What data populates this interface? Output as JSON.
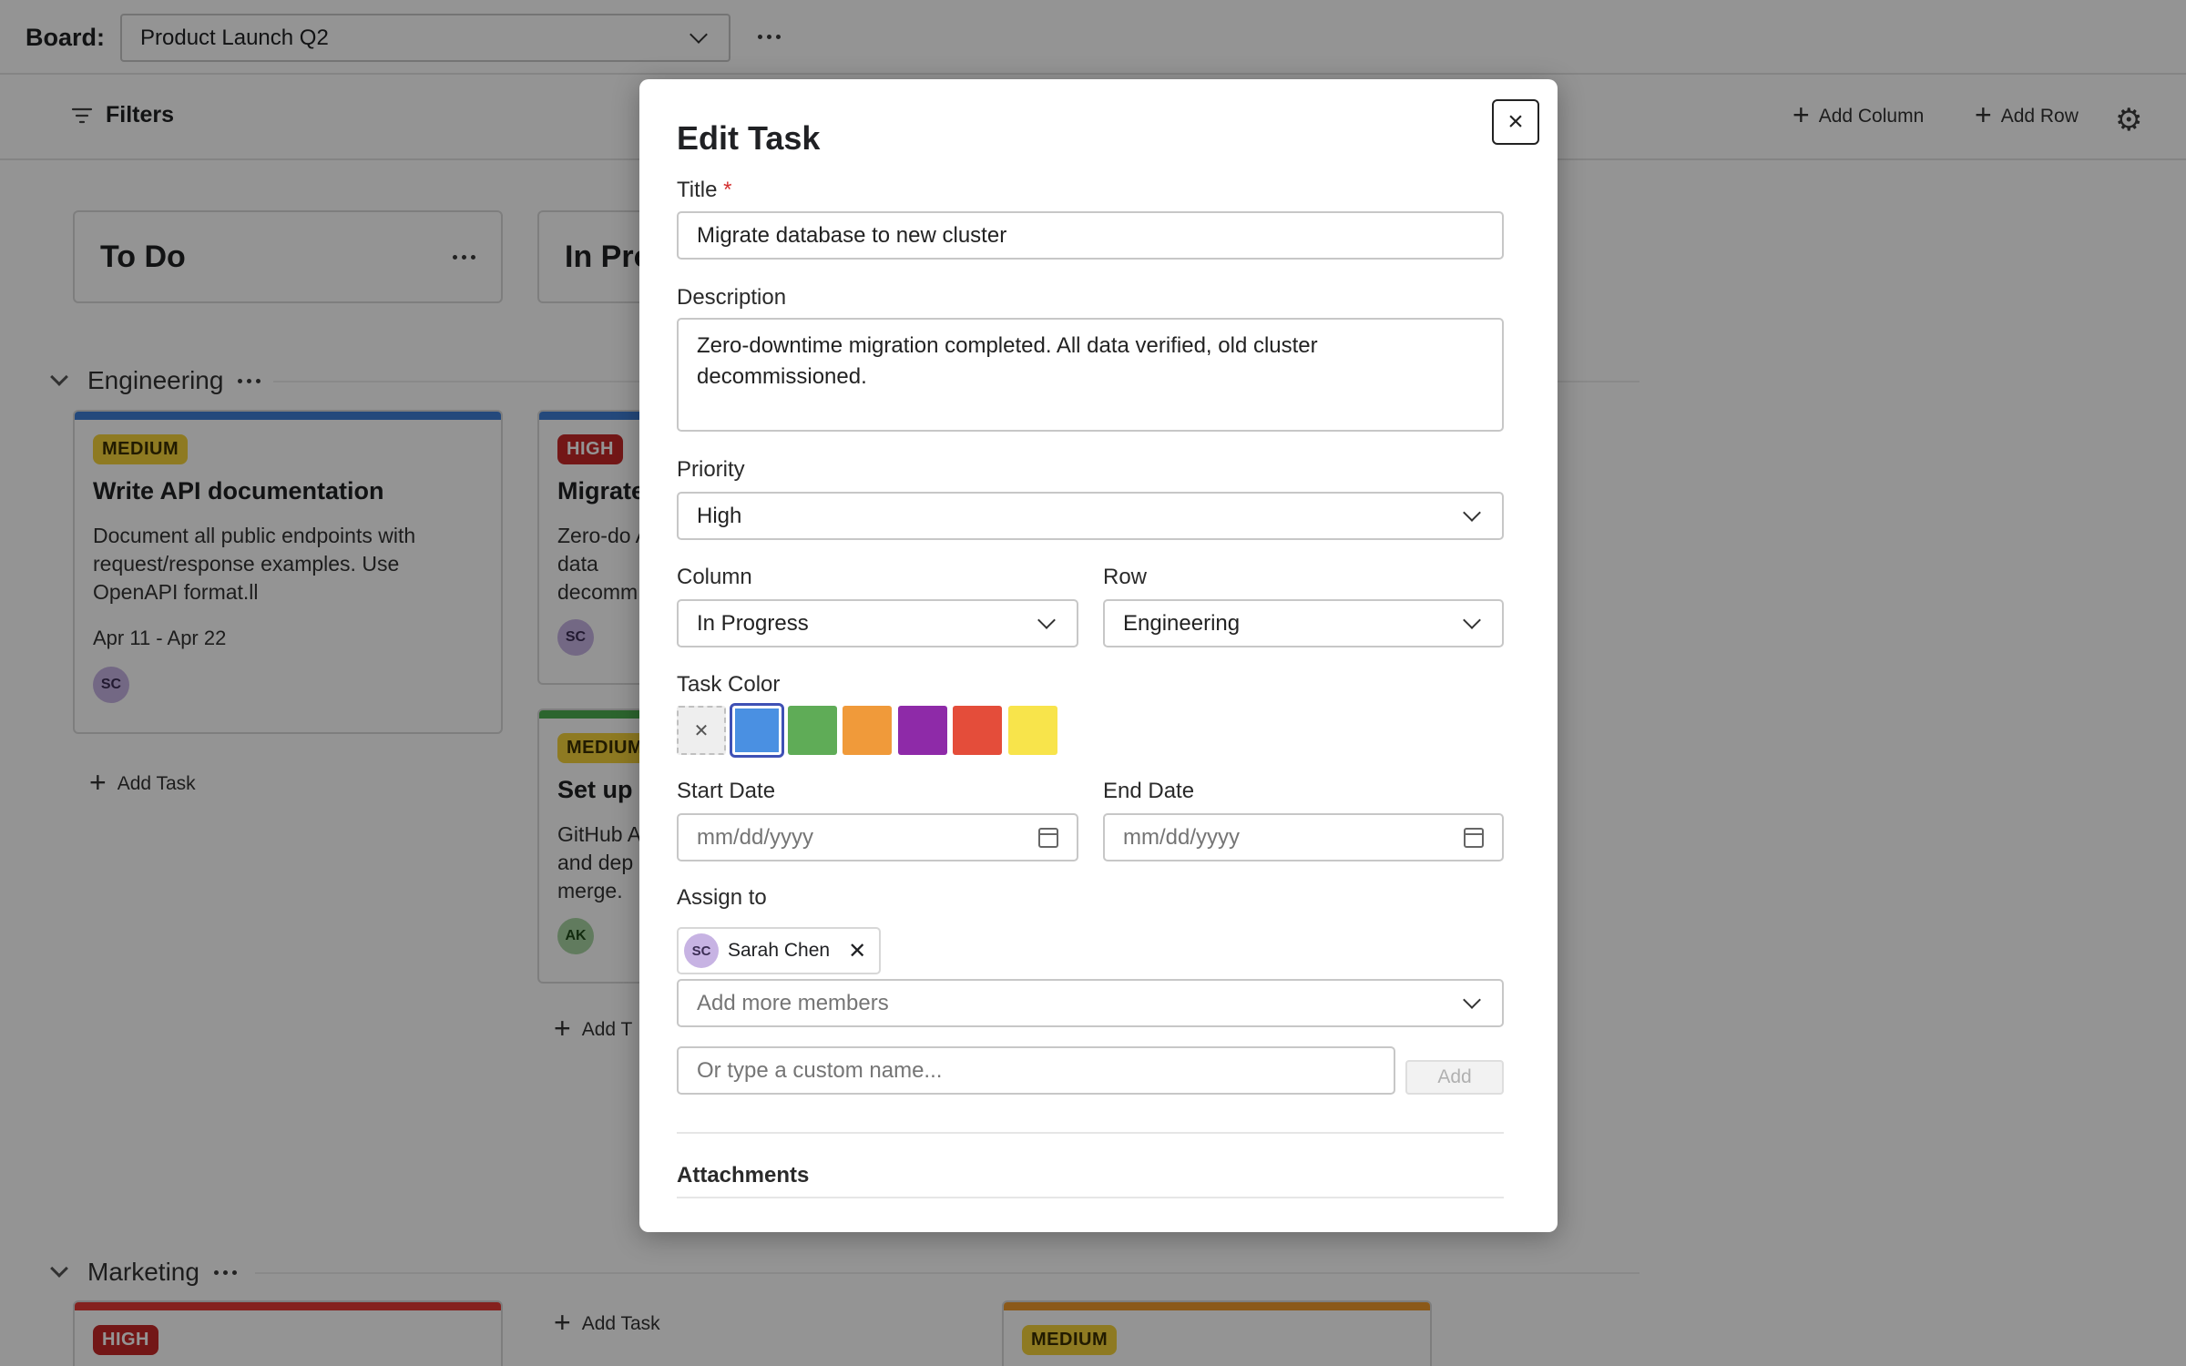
{
  "header": {
    "board_label": "Board:",
    "board_value": "Product Launch Q2"
  },
  "toolbar": {
    "filters": "Filters",
    "add_column": "Add Column",
    "add_row": "Add Row"
  },
  "columns": [
    {
      "label": "To Do"
    },
    {
      "label": "In Pro"
    }
  ],
  "groups": {
    "engineering": "Engineering",
    "marketing": "Marketing"
  },
  "cards": {
    "c1": {
      "priority": "MEDIUM",
      "title": "Write API documentation",
      "desc": "Document all public endpoints with request/response examples. Use OpenAPI format.ll",
      "dates": "Apr 11  -  Apr 22",
      "assignee": "SC",
      "stripe": "#3f7fd6"
    },
    "c2": {
      "priority": "HIGH",
      "title": "Migrate",
      "desc": "Zero-do All data decomm",
      "assignee": "SC",
      "stripe": "#3f7fd6"
    },
    "c3": {
      "priority": "MEDIUM",
      "title": "Set up",
      "desc": "GitHub A and dep merge.",
      "assignee": "AK",
      "stripe": "#4caf50"
    },
    "c4": {
      "priority": "HIGH",
      "stripe": "#e53935"
    },
    "c5": {
      "priority": "MEDIUM",
      "stripe": "#f09a2c"
    }
  },
  "add_task": "Add Task",
  "add_task_partial": "Add T",
  "modal": {
    "title": "Edit Task",
    "title_label": "Title",
    "required_mark": "*",
    "title_value": "Migrate database to new cluster",
    "description_label": "Description",
    "description_value": "Zero-downtime migration completed. All data verified, old cluster decommissioned.",
    "priority_label": "Priority",
    "priority_value": "High",
    "column_label": "Column",
    "column_value": "In Progress",
    "row_label": "Row",
    "row_value": "Engineering",
    "task_color_label": "Task Color",
    "colors": [
      "#4a90e2",
      "#5fac57",
      "#f09a3a",
      "#8e2aa8",
      "#e44d3a",
      "#f8e44b"
    ],
    "selected_color": "#4a90e2",
    "start_date_label": "Start Date",
    "start_date_placeholder": "mm/dd/yyyy",
    "end_date_label": "End Date",
    "end_date_placeholder": "mm/dd/yyyy",
    "assign_label": "Assign to",
    "assignee_initials": "SC",
    "assignee_name": "Sarah Chen",
    "add_members_placeholder": "Add more members",
    "custom_name_placeholder": "Or type a custom name...",
    "add_button": "Add",
    "attachments_label": "Attachments"
  }
}
